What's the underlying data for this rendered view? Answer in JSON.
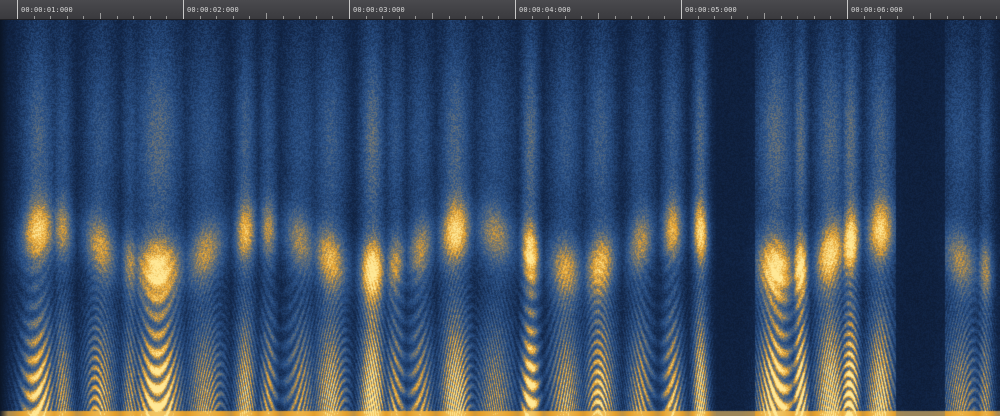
{
  "ruler": {
    "labels": [
      "00:00:01:000",
      "00:00:02:000",
      "00:00:03:000",
      "00:00:04:000",
      "00:00:05:000",
      "00:00:06:000"
    ]
  },
  "colors": {
    "background": "#0a1424",
    "low": "#0b1830",
    "mid": "#2f5c96",
    "high": "#e9a428",
    "peak": "#ffe08a",
    "ruler": "#424246"
  }
}
